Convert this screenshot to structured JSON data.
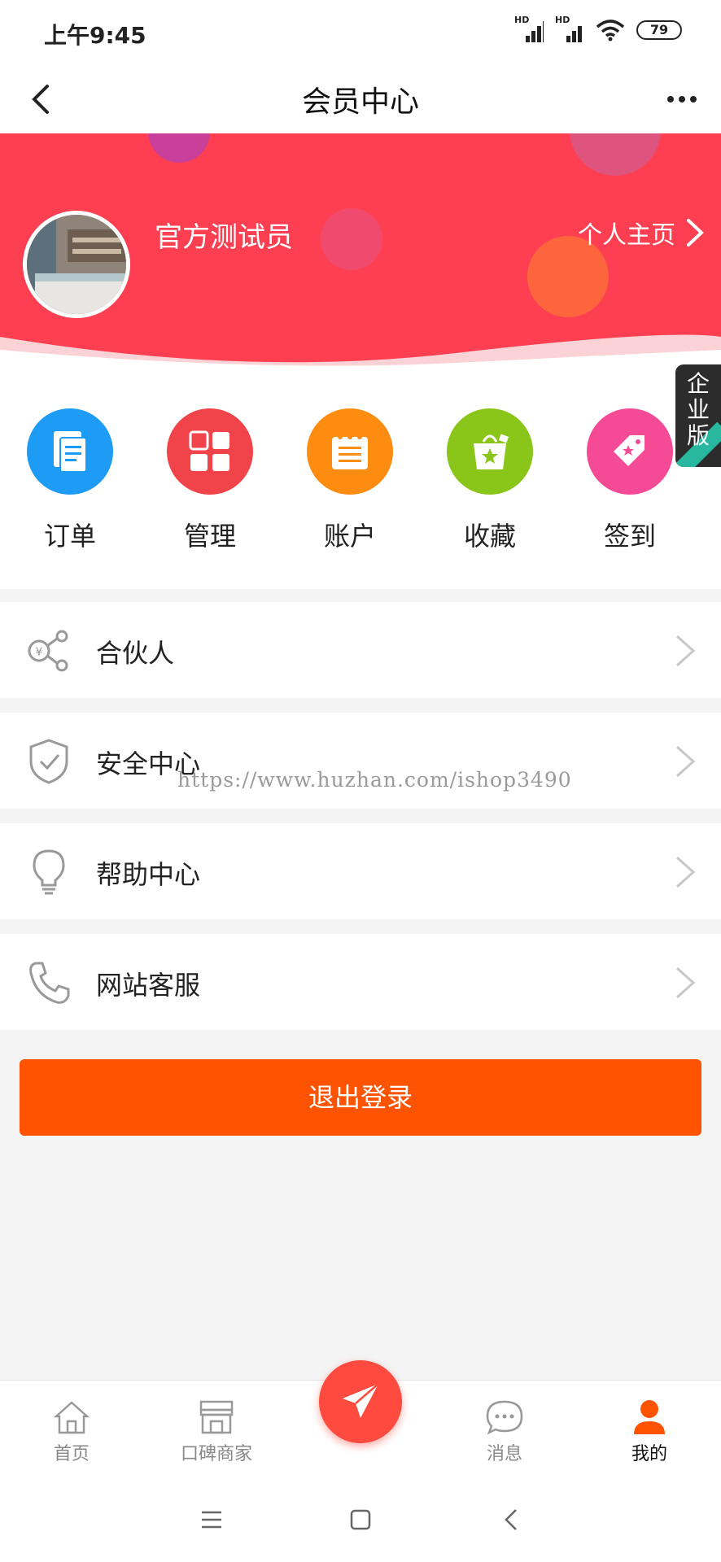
{
  "status_bar": {
    "time": "上午9:45",
    "signal1": "HD",
    "signal2": "HD",
    "battery": "79"
  },
  "nav": {
    "title": "会员中心",
    "back_icon": "chevron-left-icon",
    "more_icon": "more-dots-icon"
  },
  "profile": {
    "username": "官方测试员",
    "homepage_label": "个人主页"
  },
  "enterprise_badge": "企业版",
  "quick_actions": [
    {
      "label": "订单",
      "color": "#1e9bf5",
      "icon": "order-document-icon"
    },
    {
      "label": "管理",
      "color": "#f0434a",
      "icon": "grid-manage-icon"
    },
    {
      "label": "账户",
      "color": "#fe8c10",
      "icon": "account-notepad-icon"
    },
    {
      "label": "收藏",
      "color": "#8ac51a",
      "icon": "shopping-bag-star-icon"
    },
    {
      "label": "签到",
      "color": "#f54a96",
      "icon": "ticket-star-icon"
    }
  ],
  "menu": [
    {
      "label": "合伙人",
      "icon": "share-network-icon"
    },
    {
      "label": "安全中心",
      "icon": "shield-check-icon"
    },
    {
      "label": "帮助中心",
      "icon": "lightbulb-icon"
    },
    {
      "label": "网站客服",
      "icon": "phone-icon"
    }
  ],
  "watermark": "https://www.huzhan.com/ishop3490",
  "logout_label": "退出登录",
  "tabbar": {
    "items": [
      {
        "label": "首页",
        "icon": "home-icon"
      },
      {
        "label": "口碑商家",
        "icon": "store-icon"
      },
      {
        "label": "消息",
        "icon": "chat-bubble-icon"
      },
      {
        "label": "我的",
        "icon": "user-icon"
      }
    ],
    "active_index": 3,
    "center_icon": "paper-plane-icon"
  },
  "colors": {
    "banner": "#fe3f52",
    "logout": "#fe5402",
    "active_tab_icon": "#fe5402"
  }
}
